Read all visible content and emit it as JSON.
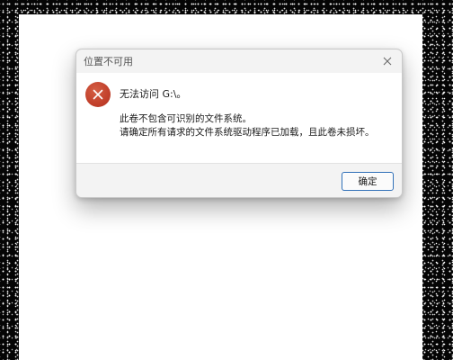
{
  "dialog": {
    "title": "位置不可用",
    "close_icon": "close-icon",
    "error_icon": "error-x-icon",
    "message": "无法访问 G:\\。",
    "detail_lines": [
      "此卷不包含可识别的文件系统。",
      "请确定所有请求的文件系统驱动程序已加载，且此卷未损坏。"
    ],
    "ok_label": "确定",
    "colors": {
      "error_red": "#c2402b",
      "button_border": "#2f6fb7"
    }
  }
}
